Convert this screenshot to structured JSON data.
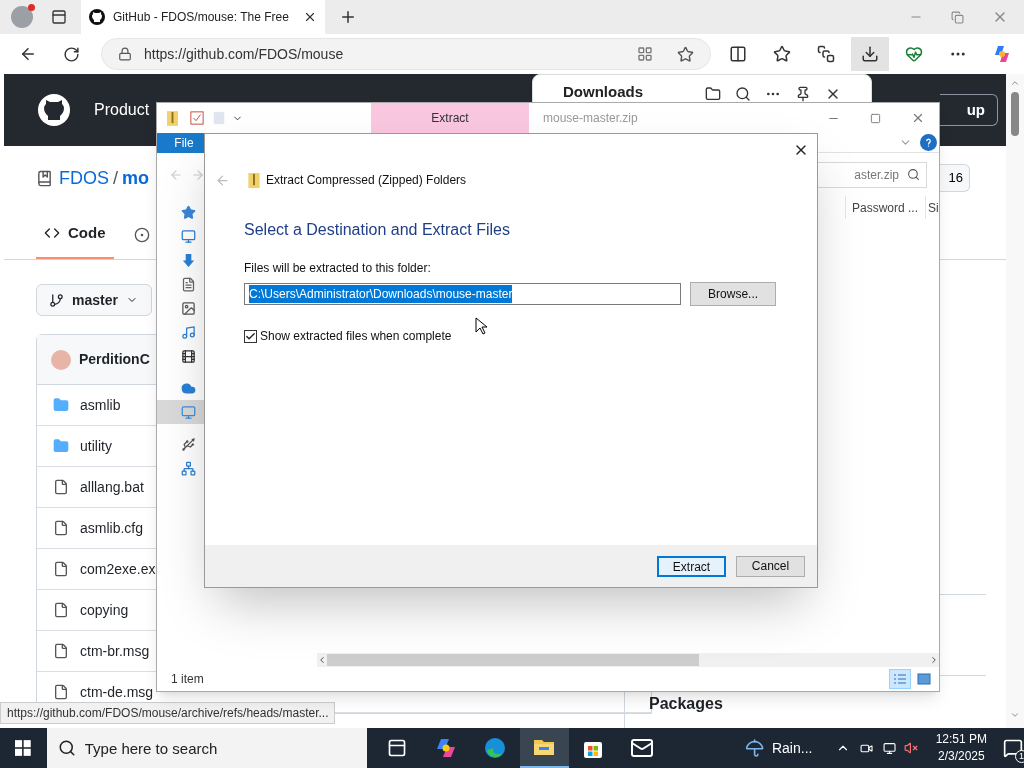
{
  "browser": {
    "tabs": [
      {
        "title": "GitHub - FDOS/mouse: The Free",
        "selected": true
      }
    ],
    "address": {
      "url": "https://github.com/FDOS/mouse"
    },
    "toolbar": [
      {
        "kind": "split",
        "selected": false
      },
      {
        "kind": "favorites",
        "selected": false
      },
      {
        "kind": "collections",
        "selected": false
      },
      {
        "kind": "downloads",
        "selected": true
      },
      {
        "kind": "health",
        "selected": false
      },
      {
        "kind": "more",
        "selected": false
      },
      {
        "kind": "copilot",
        "selected": false
      }
    ]
  },
  "github": {
    "header": {
      "nav": "Product",
      "signup": "up"
    },
    "repo": {
      "owner": "FDOS",
      "separator": "/",
      "name": "mo",
      "count": "16"
    },
    "tabs": [
      {
        "label": "Code",
        "selected": true
      }
    ],
    "branch": "master",
    "commit_author": "PerditionC",
    "files": [
      {
        "name": "asmlib",
        "kind": "folder"
      },
      {
        "name": "utility",
        "kind": "folder"
      },
      {
        "name": "alllang.bat",
        "kind": "file"
      },
      {
        "name": "asmlib.cfg",
        "kind": "file"
      },
      {
        "name": "com2exe.ex",
        "kind": "file"
      },
      {
        "name": "copying",
        "kind": "file"
      },
      {
        "name": "ctm-br.msg",
        "kind": "file"
      },
      {
        "name": "ctm-de.msg",
        "kind": "file"
      }
    ],
    "sidebar_heading": "Packages",
    "status_url": "https://github.com/FDOS/mouse/archive/refs/heads/master..."
  },
  "downloads_panel": {
    "title": "Downloads"
  },
  "explorer": {
    "ribbon_tab": "Extract",
    "title": "mouse-master.zip",
    "file_menu": "File",
    "search": "aster.zip",
    "columns": [
      "Password ...",
      "Si"
    ],
    "nav_pane": [
      {
        "kind": "quick-access",
        "selected": false
      },
      {
        "kind": "desktop",
        "selected": false
      },
      {
        "kind": "downloads",
        "selected": false
      },
      {
        "kind": "documents",
        "selected": false
      },
      {
        "kind": "pictures",
        "selected": false
      },
      {
        "kind": "music",
        "selected": false
      },
      {
        "kind": "videos",
        "selected": false
      },
      {
        "kind": "onedrive",
        "selected": false
      },
      {
        "kind": "this-pc",
        "selected": true
      },
      {
        "kind": "usb",
        "selected": false
      },
      {
        "kind": "network",
        "selected": false
      }
    ],
    "status": "1 item",
    "views": [
      {
        "kind": "details",
        "selected": true
      },
      {
        "kind": "large-icons",
        "selected": false
      }
    ]
  },
  "dialog": {
    "title": "Extract Compressed (Zipped) Folders",
    "heading": "Select a Destination and Extract Files",
    "label": "Files will be extracted to this folder:",
    "path": "C:\\Users\\Administrator\\Downloads\\mouse-master",
    "browse": "Browse...",
    "show_files": {
      "label": "Show extracted files when complete",
      "checked": true
    },
    "buttons": [
      {
        "label": "Extract",
        "kind": "default"
      },
      {
        "label": "Cancel",
        "kind": "normal"
      }
    ]
  },
  "taskbar": {
    "search_placeholder": "Type here to search",
    "apps": [
      {
        "kind": "task-view",
        "selected": false
      },
      {
        "kind": "copilot",
        "selected": false
      },
      {
        "kind": "edge",
        "selected": false
      },
      {
        "kind": "explorer",
        "selected": true
      },
      {
        "kind": "store",
        "selected": false
      },
      {
        "kind": "mail",
        "selected": false
      }
    ],
    "weather": "Rain...",
    "time": "12:51 PM",
    "date": "2/3/2025",
    "notifications": "1"
  }
}
